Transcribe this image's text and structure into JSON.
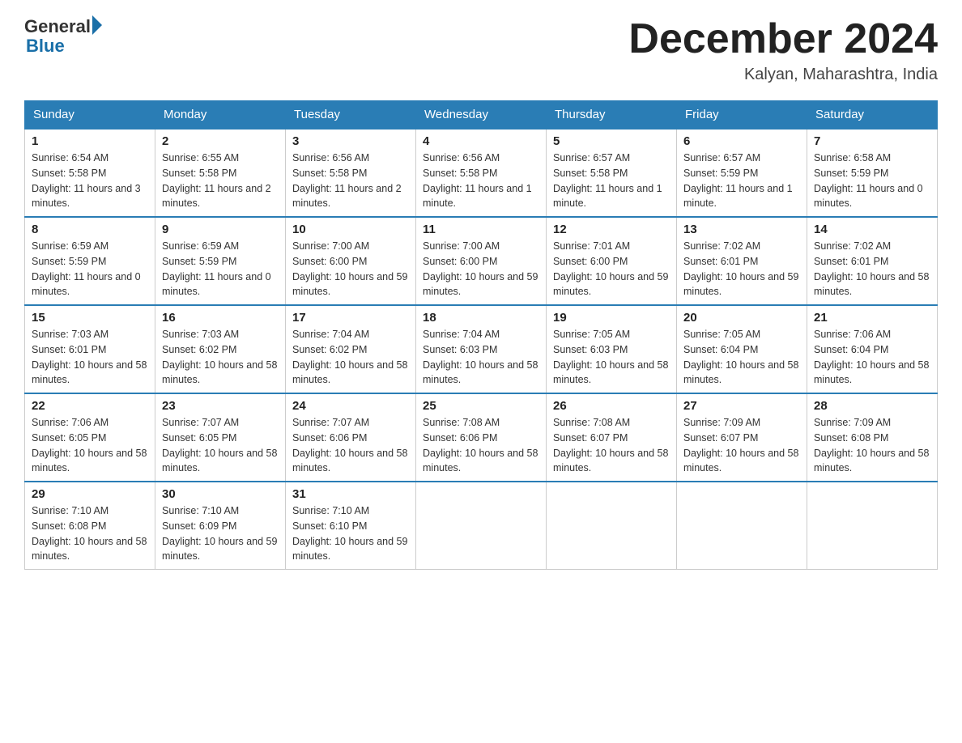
{
  "header": {
    "logo_general": "General",
    "logo_blue": "Blue",
    "month_title": "December 2024",
    "location": "Kalyan, Maharashtra, India"
  },
  "days_of_week": [
    "Sunday",
    "Monday",
    "Tuesday",
    "Wednesday",
    "Thursday",
    "Friday",
    "Saturday"
  ],
  "weeks": [
    [
      {
        "num": "1",
        "sunrise": "6:54 AM",
        "sunset": "5:58 PM",
        "daylight": "11 hours and 3 minutes."
      },
      {
        "num": "2",
        "sunrise": "6:55 AM",
        "sunset": "5:58 PM",
        "daylight": "11 hours and 2 minutes."
      },
      {
        "num": "3",
        "sunrise": "6:56 AM",
        "sunset": "5:58 PM",
        "daylight": "11 hours and 2 minutes."
      },
      {
        "num": "4",
        "sunrise": "6:56 AM",
        "sunset": "5:58 PM",
        "daylight": "11 hours and 1 minute."
      },
      {
        "num": "5",
        "sunrise": "6:57 AM",
        "sunset": "5:58 PM",
        "daylight": "11 hours and 1 minute."
      },
      {
        "num": "6",
        "sunrise": "6:57 AM",
        "sunset": "5:59 PM",
        "daylight": "11 hours and 1 minute."
      },
      {
        "num": "7",
        "sunrise": "6:58 AM",
        "sunset": "5:59 PM",
        "daylight": "11 hours and 0 minutes."
      }
    ],
    [
      {
        "num": "8",
        "sunrise": "6:59 AM",
        "sunset": "5:59 PM",
        "daylight": "11 hours and 0 minutes."
      },
      {
        "num": "9",
        "sunrise": "6:59 AM",
        "sunset": "5:59 PM",
        "daylight": "11 hours and 0 minutes."
      },
      {
        "num": "10",
        "sunrise": "7:00 AM",
        "sunset": "6:00 PM",
        "daylight": "10 hours and 59 minutes."
      },
      {
        "num": "11",
        "sunrise": "7:00 AM",
        "sunset": "6:00 PM",
        "daylight": "10 hours and 59 minutes."
      },
      {
        "num": "12",
        "sunrise": "7:01 AM",
        "sunset": "6:00 PM",
        "daylight": "10 hours and 59 minutes."
      },
      {
        "num": "13",
        "sunrise": "7:02 AM",
        "sunset": "6:01 PM",
        "daylight": "10 hours and 59 minutes."
      },
      {
        "num": "14",
        "sunrise": "7:02 AM",
        "sunset": "6:01 PM",
        "daylight": "10 hours and 58 minutes."
      }
    ],
    [
      {
        "num": "15",
        "sunrise": "7:03 AM",
        "sunset": "6:01 PM",
        "daylight": "10 hours and 58 minutes."
      },
      {
        "num": "16",
        "sunrise": "7:03 AM",
        "sunset": "6:02 PM",
        "daylight": "10 hours and 58 minutes."
      },
      {
        "num": "17",
        "sunrise": "7:04 AM",
        "sunset": "6:02 PM",
        "daylight": "10 hours and 58 minutes."
      },
      {
        "num": "18",
        "sunrise": "7:04 AM",
        "sunset": "6:03 PM",
        "daylight": "10 hours and 58 minutes."
      },
      {
        "num": "19",
        "sunrise": "7:05 AM",
        "sunset": "6:03 PM",
        "daylight": "10 hours and 58 minutes."
      },
      {
        "num": "20",
        "sunrise": "7:05 AM",
        "sunset": "6:04 PM",
        "daylight": "10 hours and 58 minutes."
      },
      {
        "num": "21",
        "sunrise": "7:06 AM",
        "sunset": "6:04 PM",
        "daylight": "10 hours and 58 minutes."
      }
    ],
    [
      {
        "num": "22",
        "sunrise": "7:06 AM",
        "sunset": "6:05 PM",
        "daylight": "10 hours and 58 minutes."
      },
      {
        "num": "23",
        "sunrise": "7:07 AM",
        "sunset": "6:05 PM",
        "daylight": "10 hours and 58 minutes."
      },
      {
        "num": "24",
        "sunrise": "7:07 AM",
        "sunset": "6:06 PM",
        "daylight": "10 hours and 58 minutes."
      },
      {
        "num": "25",
        "sunrise": "7:08 AM",
        "sunset": "6:06 PM",
        "daylight": "10 hours and 58 minutes."
      },
      {
        "num": "26",
        "sunrise": "7:08 AM",
        "sunset": "6:07 PM",
        "daylight": "10 hours and 58 minutes."
      },
      {
        "num": "27",
        "sunrise": "7:09 AM",
        "sunset": "6:07 PM",
        "daylight": "10 hours and 58 minutes."
      },
      {
        "num": "28",
        "sunrise": "7:09 AM",
        "sunset": "6:08 PM",
        "daylight": "10 hours and 58 minutes."
      }
    ],
    [
      {
        "num": "29",
        "sunrise": "7:10 AM",
        "sunset": "6:08 PM",
        "daylight": "10 hours and 58 minutes."
      },
      {
        "num": "30",
        "sunrise": "7:10 AM",
        "sunset": "6:09 PM",
        "daylight": "10 hours and 59 minutes."
      },
      {
        "num": "31",
        "sunrise": "7:10 AM",
        "sunset": "6:10 PM",
        "daylight": "10 hours and 59 minutes."
      },
      null,
      null,
      null,
      null
    ]
  ]
}
